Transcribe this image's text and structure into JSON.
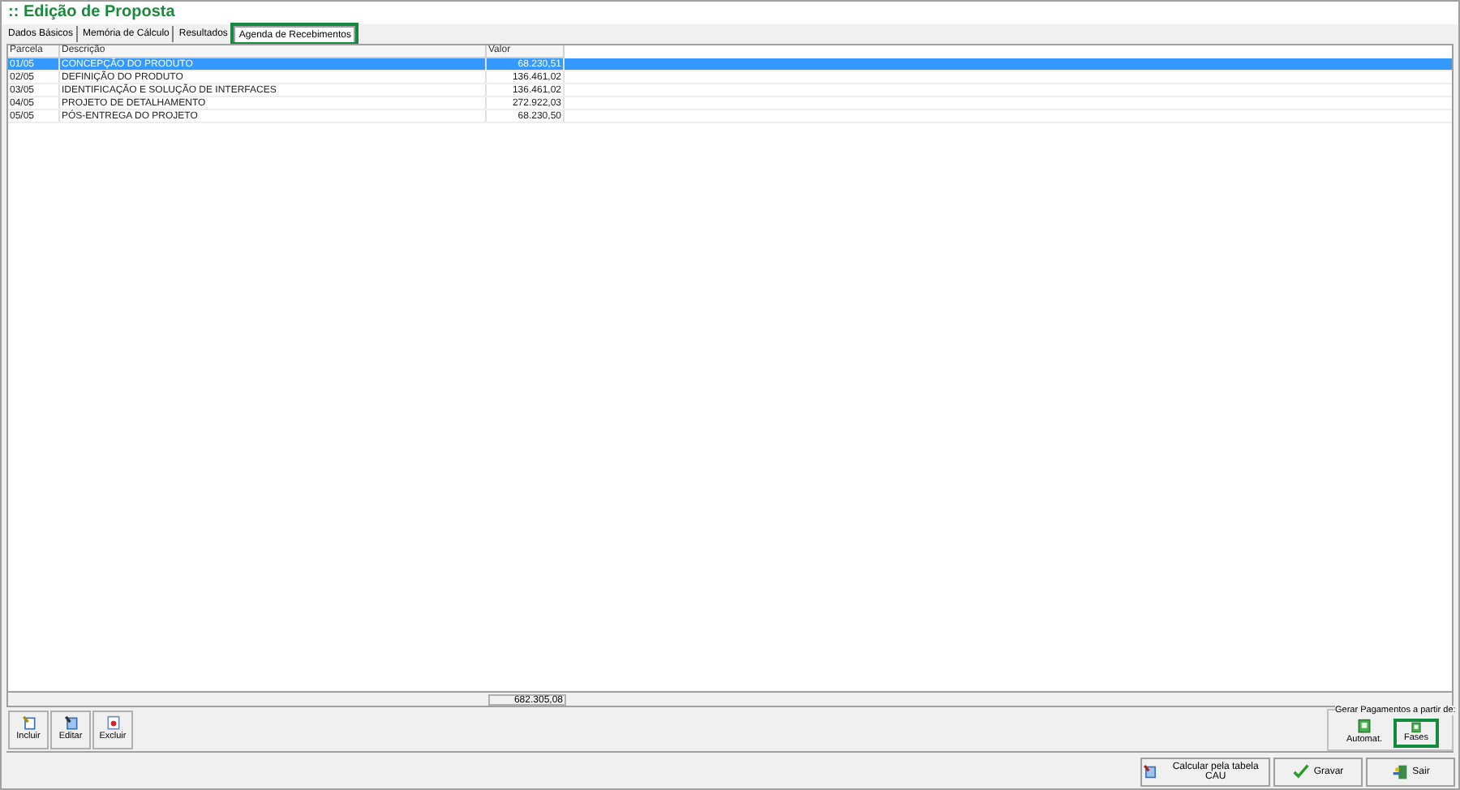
{
  "window": {
    "title": ":: Edição de Proposta"
  },
  "tabs": [
    {
      "label": "Dados Básicos",
      "selected": false,
      "highlighted": false
    },
    {
      "label": "Memória de Cálculo",
      "selected": false,
      "highlighted": false
    },
    {
      "label": "Resultados",
      "selected": false,
      "highlighted": false
    },
    {
      "label": "Agenda de Recebimentos",
      "selected": true,
      "highlighted": true
    }
  ],
  "table": {
    "columns": [
      "Parcela",
      "Descrição",
      "Valor"
    ],
    "rows": [
      {
        "cells": [
          "01/05",
          "CONCEPÇÃO DO PRODUTO",
          "68.230,51"
        ],
        "selected": true
      },
      {
        "cells": [
          "02/05",
          "DEFINIÇÃO DO PRODUTO",
          "136.461,02"
        ],
        "selected": false
      },
      {
        "cells": [
          "03/05",
          "IDENTIFICAÇÃO E SOLUÇÃO DE INTERFACES",
          "136.461,02"
        ],
        "selected": false
      },
      {
        "cells": [
          "04/05",
          "PROJETO DE DETALHAMENTO",
          "272.922,03"
        ],
        "selected": false
      },
      {
        "cells": [
          "05/05",
          "PÓS-ENTREGA DO PROJETO",
          "68.230,50"
        ],
        "selected": false
      }
    ],
    "total": "682.305,08"
  },
  "actions": [
    {
      "label": "Incluir",
      "kind": "add"
    },
    {
      "label": "Editar",
      "kind": "edit"
    },
    {
      "label": "Excluir",
      "kind": "delete"
    }
  ],
  "generate": {
    "title": "Gerar Pagamentos a partir de:",
    "buttons": [
      {
        "label": "Automat.",
        "highlighted": false
      },
      {
        "label": "Fases",
        "highlighted": true
      }
    ]
  },
  "footer": [
    {
      "label": "Calcular pela tabela CAU",
      "kind": "calc"
    },
    {
      "label": "Gravar",
      "kind": "save"
    },
    {
      "label": "Sair",
      "kind": "exit"
    }
  ]
}
